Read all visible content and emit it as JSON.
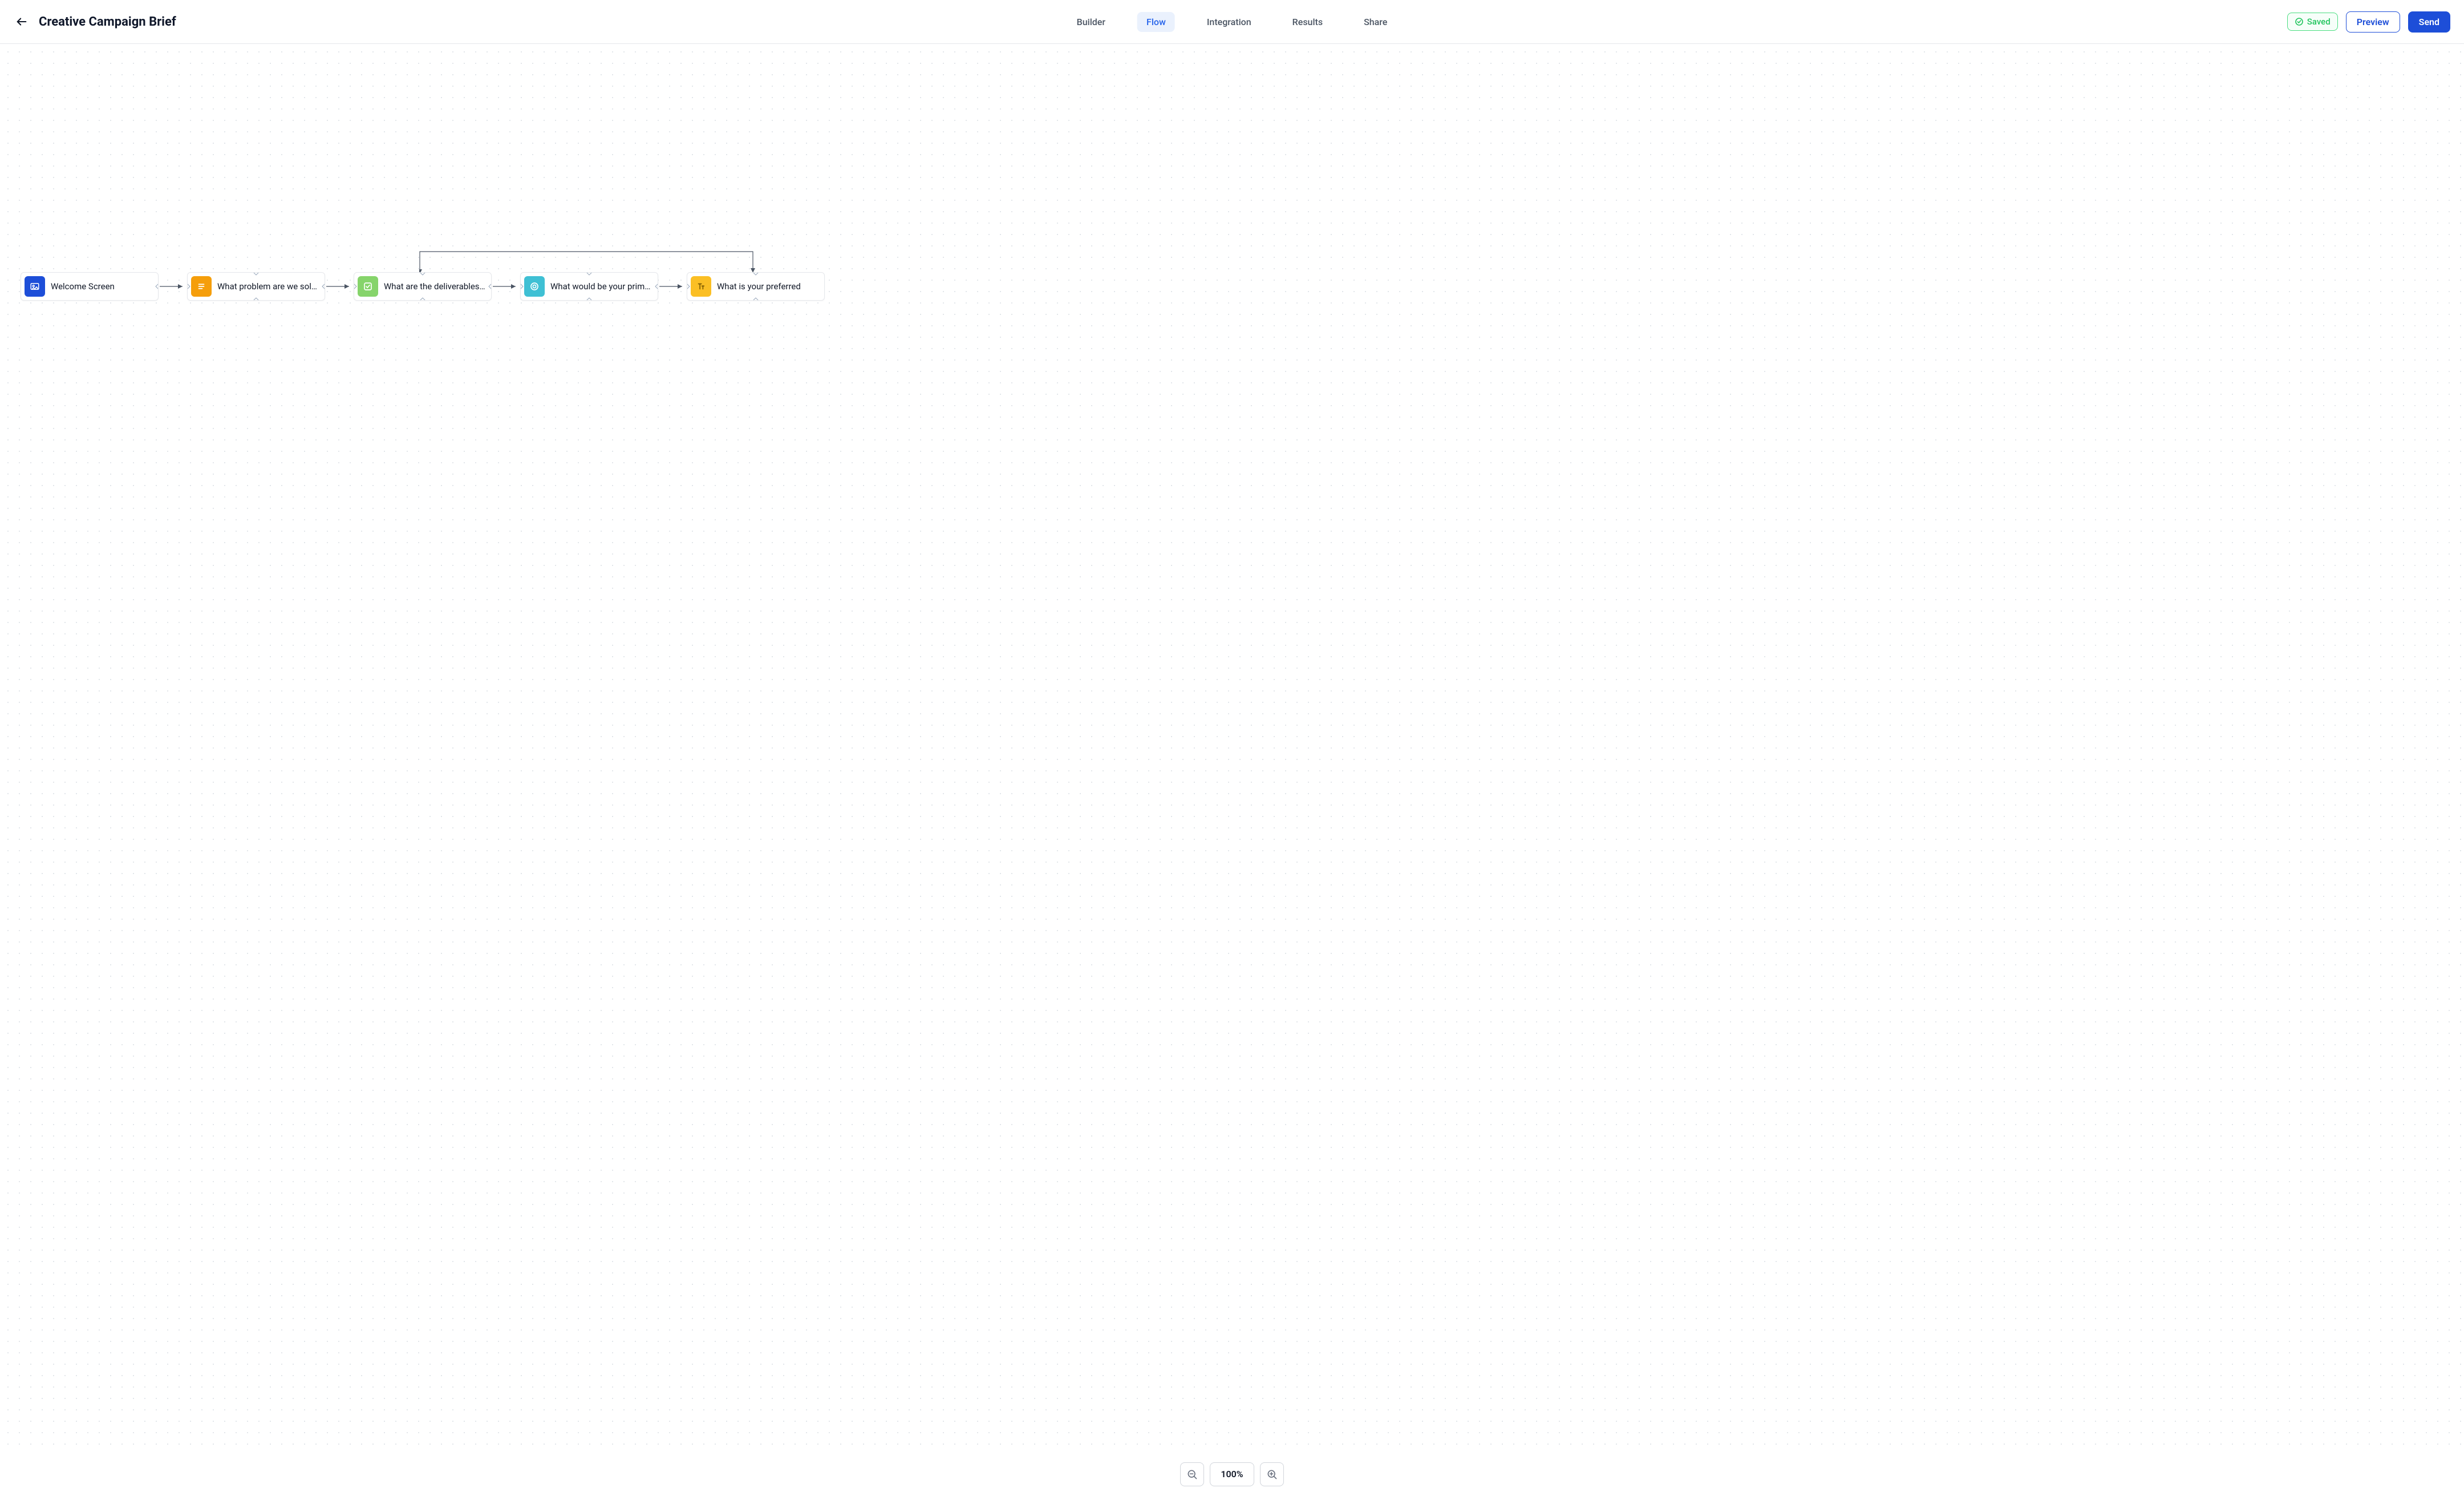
{
  "header": {
    "title": "Creative Campaign Brief",
    "nav": {
      "builder": "Builder",
      "flow": "Flow",
      "integration": "Integration",
      "results": "Results",
      "share": "Share"
    },
    "saved_label": "Saved",
    "preview_label": "Preview",
    "send_label": "Send"
  },
  "flow": {
    "nodes": [
      {
        "label": "Welcome Screen",
        "icon": "welcome-icon",
        "color": "blue"
      },
      {
        "label": "What problem are we solvi...",
        "icon": "list-icon",
        "color": "orange"
      },
      {
        "label": "What are the deliverables f..",
        "icon": "checkbox-icon",
        "color": "green"
      },
      {
        "label": "What would be your prima...",
        "icon": "target-icon",
        "color": "cyan"
      },
      {
        "label": "What is your preferred ",
        "icon": "text-icon",
        "color": "yellow"
      }
    ]
  },
  "zoom": {
    "level": "100%"
  }
}
